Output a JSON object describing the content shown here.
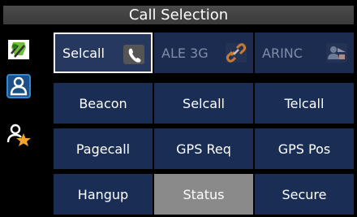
{
  "title": "Call Selection",
  "sidebar": {
    "items": [
      {
        "icon": "network-call-icon",
        "selected": false
      },
      {
        "icon": "single-user-icon",
        "selected": true
      },
      {
        "icon": "favorite-user-icon",
        "selected": false
      }
    ]
  },
  "tabs": [
    {
      "label": "Selcall",
      "icon": "handset-icon",
      "active": true
    },
    {
      "label": "ALE 3G",
      "icon": "link-icon",
      "active": false
    },
    {
      "label": "ARINC",
      "icon": "arinc-icon",
      "active": false
    }
  ],
  "buttons": [
    {
      "label": "Beacon"
    },
    {
      "label": "Selcall"
    },
    {
      "label": "Telcall"
    },
    {
      "label": "Pagecall"
    },
    {
      "label": "GPS Req"
    },
    {
      "label": "GPS Pos"
    },
    {
      "label": "Hangup"
    },
    {
      "label": "Status",
      "highlighted": true
    },
    {
      "label": "Secure"
    }
  ],
  "colors": {
    "background": "#000000",
    "button": "#1a2e55",
    "highlight": "#8a8a8a",
    "sidebar_accent": "#2e8bd0",
    "star": "#f5a623"
  }
}
